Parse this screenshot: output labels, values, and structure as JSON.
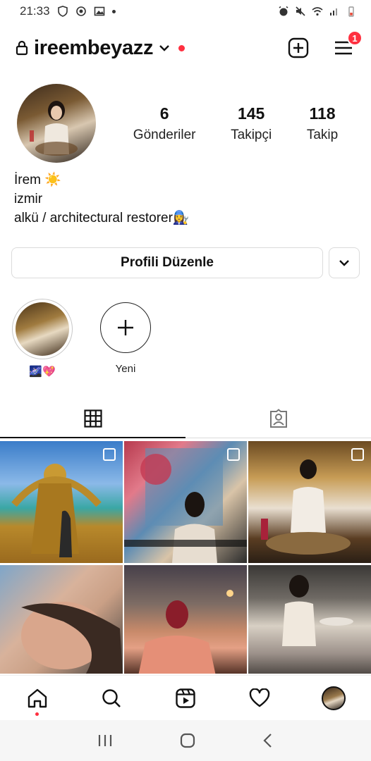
{
  "status_bar": {
    "time": "21:33"
  },
  "header": {
    "username": "ireembeyazz",
    "notification_count": "1"
  },
  "profile": {
    "stats": [
      {
        "value": "6",
        "label": "Gönderiler"
      },
      {
        "value": "145",
        "label": "Takipçi"
      },
      {
        "value": "118",
        "label": "Takip"
      }
    ],
    "bio": {
      "name": "İrem ☀️",
      "city": "izmir",
      "description": "alkü / architectural restorer👩‍🔧"
    }
  },
  "actions": {
    "edit_profile": "Profili Düzenle"
  },
  "highlights": [
    {
      "label": "🌌💖"
    },
    {
      "label": "Yeni"
    }
  ],
  "colors": {
    "accent_red": "#ff3040",
    "border": "#dbdbdb",
    "text": "#111111"
  }
}
